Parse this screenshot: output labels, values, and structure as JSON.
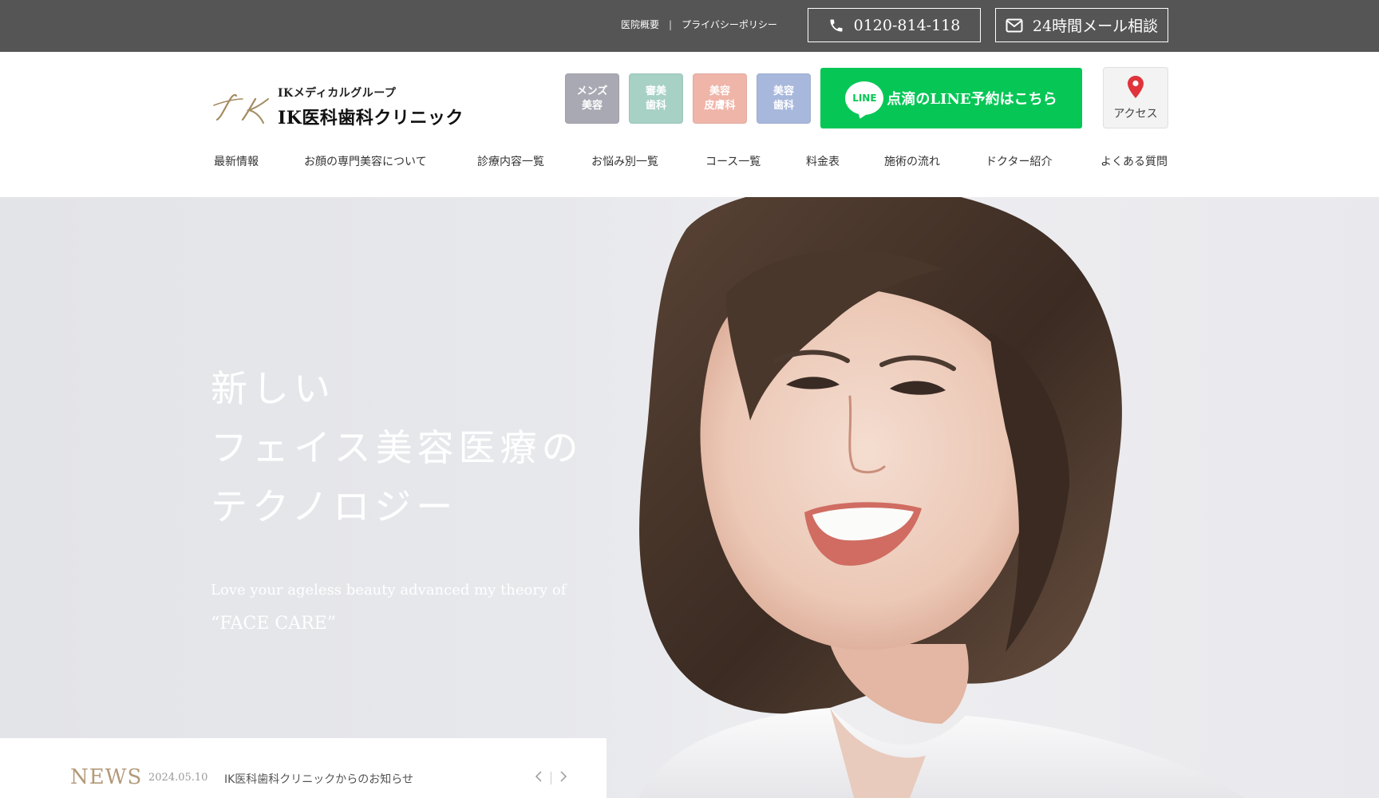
{
  "topbar": {
    "links": [
      "医院概要",
      "プライバシーポリシー"
    ],
    "tel": "0120-814-118",
    "mail": "24時間メール相談"
  },
  "header": {
    "logo_group": "IKメディカルグループ",
    "logo_name": "IK医科歯科クリニック",
    "categories": [
      {
        "line1": "メンズ",
        "line2": "美容"
      },
      {
        "line1": "審美",
        "line2": "歯科"
      },
      {
        "line1": "美容",
        "line2": "皮膚科"
      },
      {
        "line1": "美容",
        "line2": "歯科"
      }
    ],
    "line_label": "点滴のLINE予約はこちら",
    "line_logo": "LINE",
    "access_label": "アクセス"
  },
  "nav": [
    "最新情報",
    "お顔の専門美容について",
    "診療内容一覧",
    "お悩み別一覧",
    "コース一覧",
    "料金表",
    "施術の流れ",
    "ドクター紹介",
    "よくある質問"
  ],
  "hero": {
    "title_lines": [
      "新しい",
      "フェイス美容医療の",
      "テクノロジー"
    ],
    "sub_line1": "Love your ageless beauty advanced my theory of",
    "sub_line2": "“FACE CARE”"
  },
  "news": {
    "label": "NEWS",
    "date": "2024.05.10",
    "title": "IK医科歯科クリニックからのお知らせ"
  },
  "colors": {
    "topbar": "#555555",
    "line_green": "#06c755",
    "mens": "#a9a9b3",
    "shinbi": "#a7d1c5",
    "hifu": "#efb5a9",
    "biyou": "#a8b8dc",
    "news_label": "#b39a7a"
  },
  "icons": [
    "phone-icon",
    "mail-icon",
    "line-logo-icon",
    "map-pin-icon",
    "chevron-left-icon",
    "chevron-right-icon"
  ]
}
